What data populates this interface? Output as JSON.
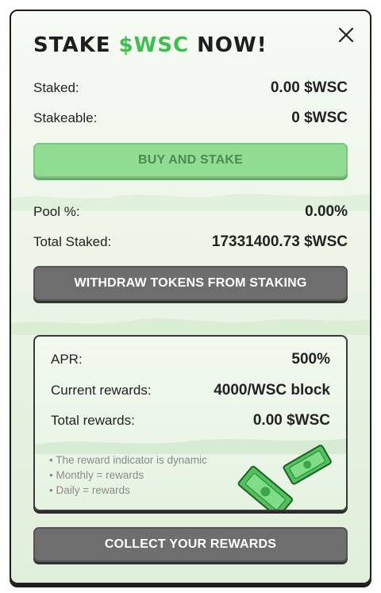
{
  "modal": {
    "title_prefix": "STAKE ",
    "title_token": "$WSC",
    "title_suffix": " NOW!",
    "close_icon": "close-icon"
  },
  "stake_info": {
    "staked_label": "Staked:",
    "staked_value": "0.00 $WSC",
    "stakeable_label": "Stakeable:",
    "stakeable_value": "0 $WSC"
  },
  "buy_button": {
    "label": "BUY AND STAKE"
  },
  "pool_info": {
    "pool_label": "Pool %:",
    "pool_value": "0.00%",
    "total_label": "Total Staked:",
    "total_value": "17331400.73 $WSC"
  },
  "withdraw_button": {
    "label": "WITHDRAW TOKENS FROM STAKING"
  },
  "rewards_panel": {
    "apr_label": "APR:",
    "apr_value": "500%",
    "current_label": "Current rewards:",
    "current_value": "4000/WSC block",
    "total_label": "Total rewards:",
    "total_value": "0.00 $WSC",
    "notes": [
      "• The reward indicator is dynamic",
      "• Monthly = rewards",
      "• Daily = rewards"
    ],
    "illustration": "money-bills-icon"
  },
  "collect_button": {
    "label": "COLLECT YOUR REWARDS"
  },
  "colors": {
    "accent_green": "#3fbf4f",
    "button_green": "#8fdc92",
    "button_dark": "#6e6e6e",
    "text_dark": "#1e1e1e"
  }
}
